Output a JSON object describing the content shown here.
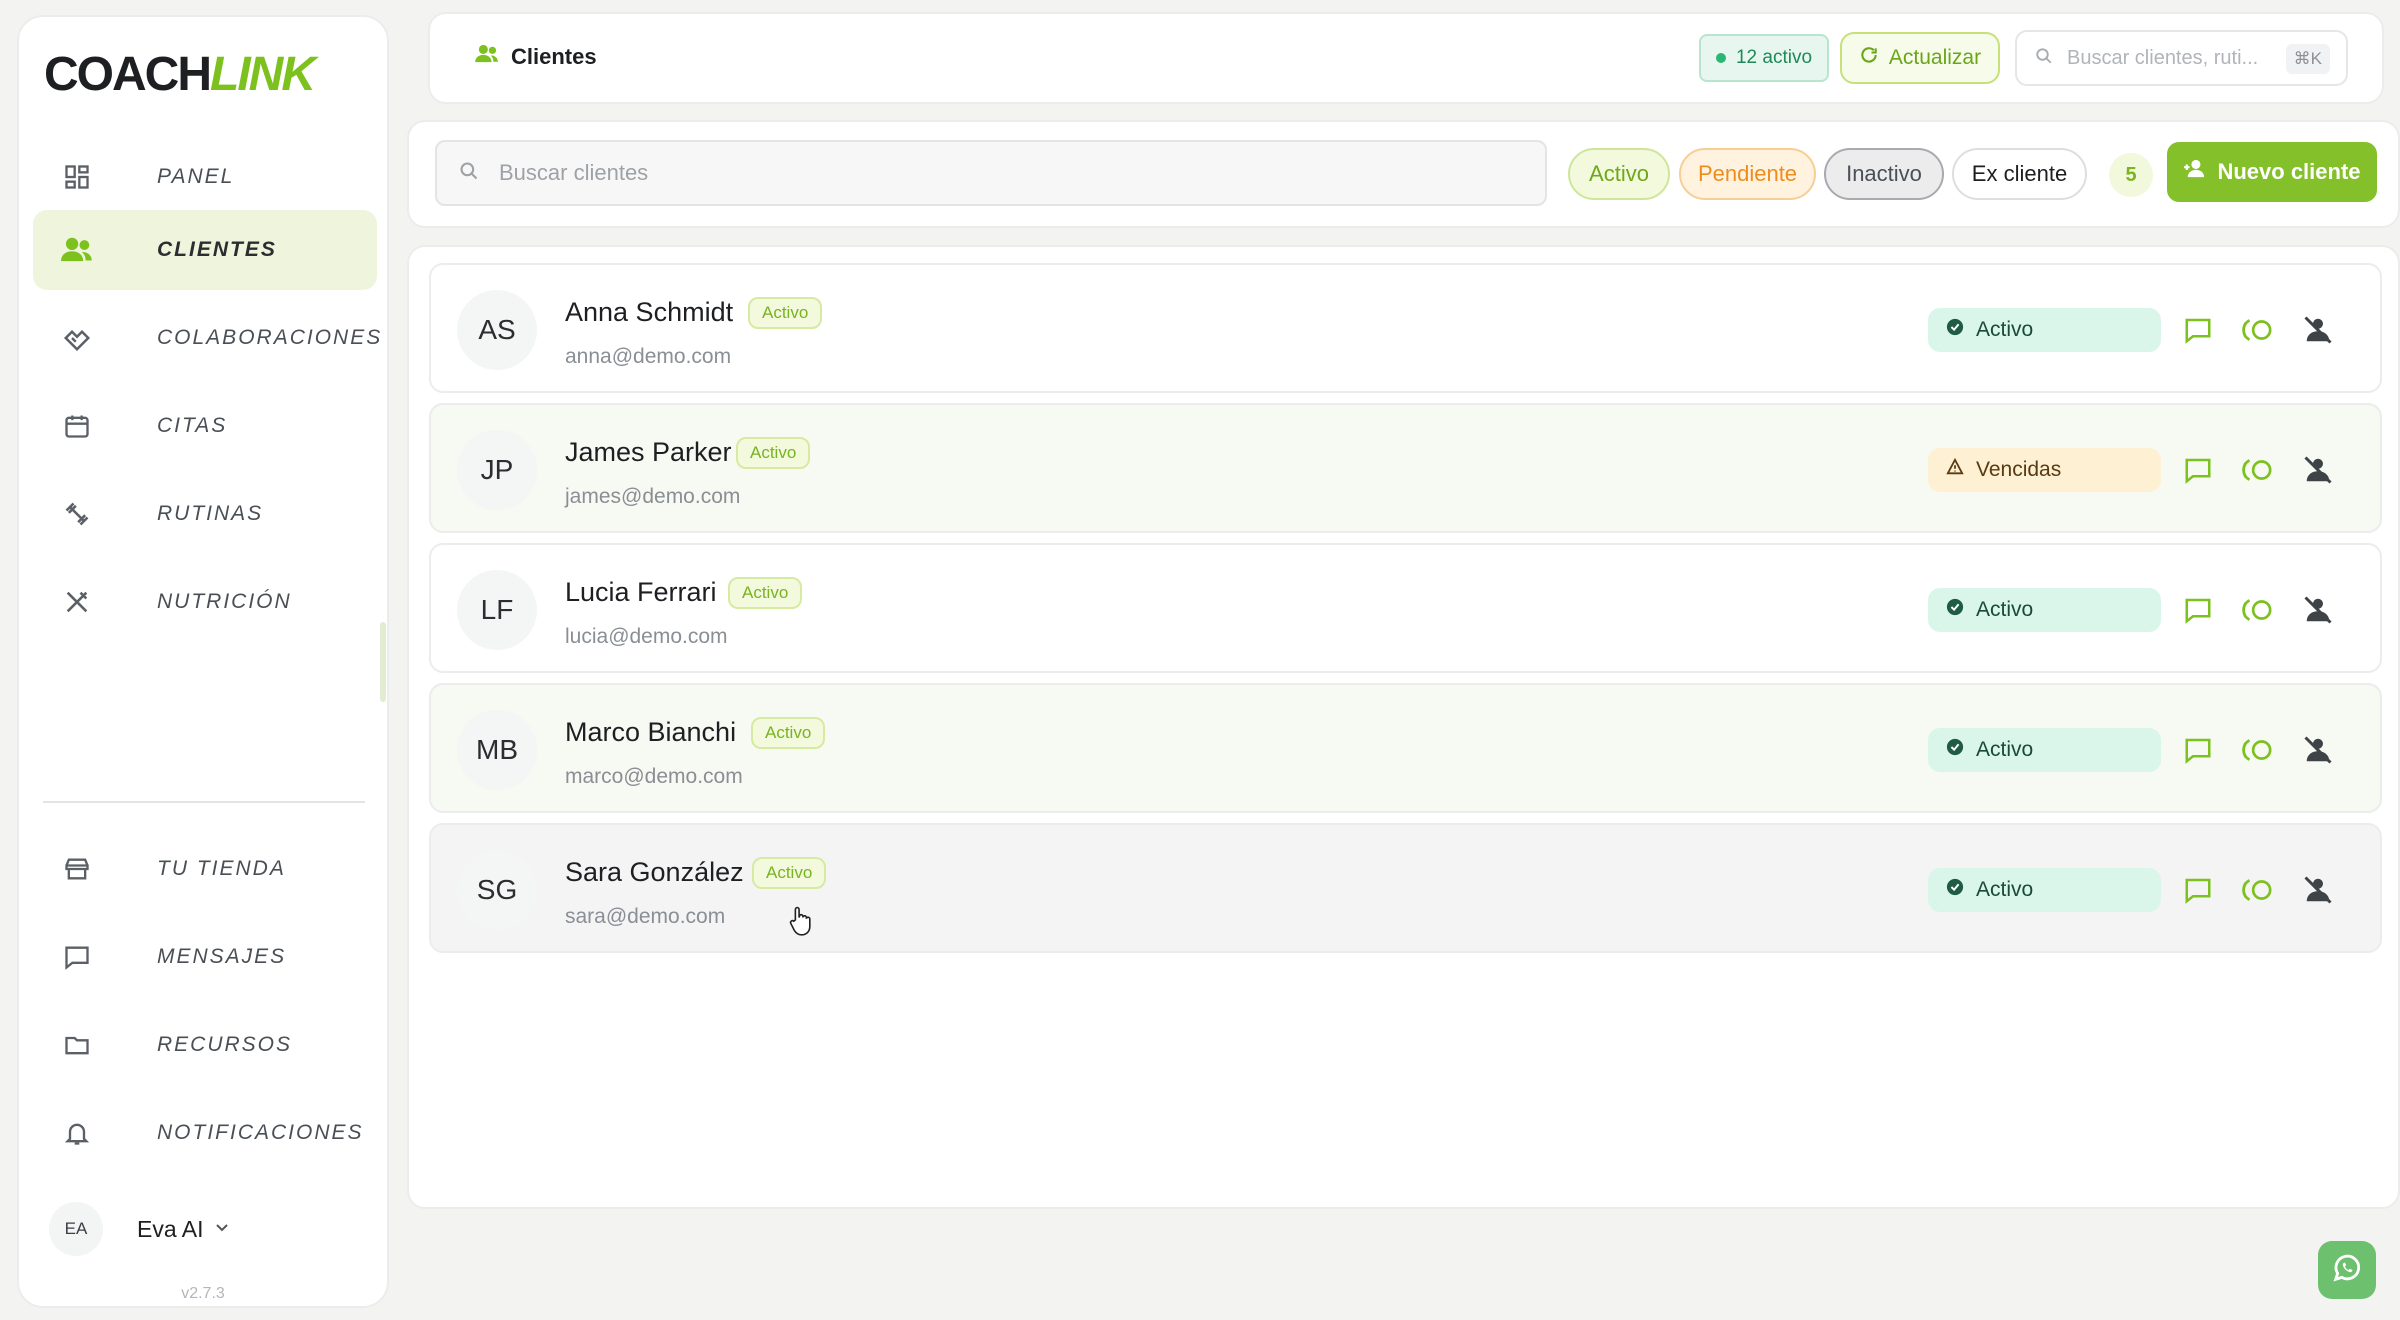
{
  "brand": {
    "part1": "COACH",
    "part2": "LINK"
  },
  "sidebar": {
    "items": [
      {
        "label": "PANEL",
        "icon": "dashboard-icon"
      },
      {
        "label": "CLIENTES",
        "icon": "users-icon",
        "active": true
      },
      {
        "label": "COLABORACIONES",
        "icon": "handshake-icon"
      },
      {
        "label": "CITAS",
        "icon": "calendar-icon"
      },
      {
        "label": "RUTINAS",
        "icon": "dumbbell-icon"
      },
      {
        "label": "NUTRICIÓN",
        "icon": "utensils-icon"
      }
    ],
    "bottom_items": [
      {
        "label": "TU TIENDA",
        "icon": "store-icon"
      },
      {
        "label": "MENSAJES",
        "icon": "message-icon"
      },
      {
        "label": "RECURSOS",
        "icon": "folder-icon"
      },
      {
        "label": "NOTIFICACIONES",
        "icon": "bell-icon"
      }
    ],
    "user": {
      "initials": "EA",
      "name": "Eva AI"
    },
    "version": "v2.7.3"
  },
  "header": {
    "title": "Clientes",
    "online_badge": "12 activo",
    "refresh_label": "Actualizar",
    "search_placeholder": "Buscar clientes, ruti...",
    "shortcut": "⌘K"
  },
  "filters": {
    "search_placeholder": "Buscar clientes",
    "chips": {
      "active": "Activo",
      "pending": "Pendiente",
      "inactive": "Inactivo",
      "former": "Ex cliente"
    },
    "count": "5",
    "new_client_label": "Nuevo cliente"
  },
  "clients": [
    {
      "initials": "AS",
      "name": "Anna Schmidt",
      "tag": "Activo",
      "email": "anna@demo.com",
      "status": "Activo",
      "status_kind": "ok"
    },
    {
      "initials": "JP",
      "name": "James Parker",
      "tag": "Activo",
      "email": "james@demo.com",
      "status": "Vencidas",
      "status_kind": "warn"
    },
    {
      "initials": "LF",
      "name": "Lucia Ferrari",
      "tag": "Activo",
      "email": "lucia@demo.com",
      "status": "Activo",
      "status_kind": "ok"
    },
    {
      "initials": "MB",
      "name": "Marco Bianchi",
      "tag": "Activo",
      "email": "marco@demo.com",
      "status": "Activo",
      "status_kind": "ok"
    },
    {
      "initials": "SG",
      "name": "Sara González",
      "tag": "Activo",
      "email": "sara@demo.com",
      "status": "Activo",
      "status_kind": "ok"
    }
  ],
  "colors": {
    "accent": "#84c02a",
    "ok": "#2bb673",
    "warn": "#ee8d1c"
  }
}
